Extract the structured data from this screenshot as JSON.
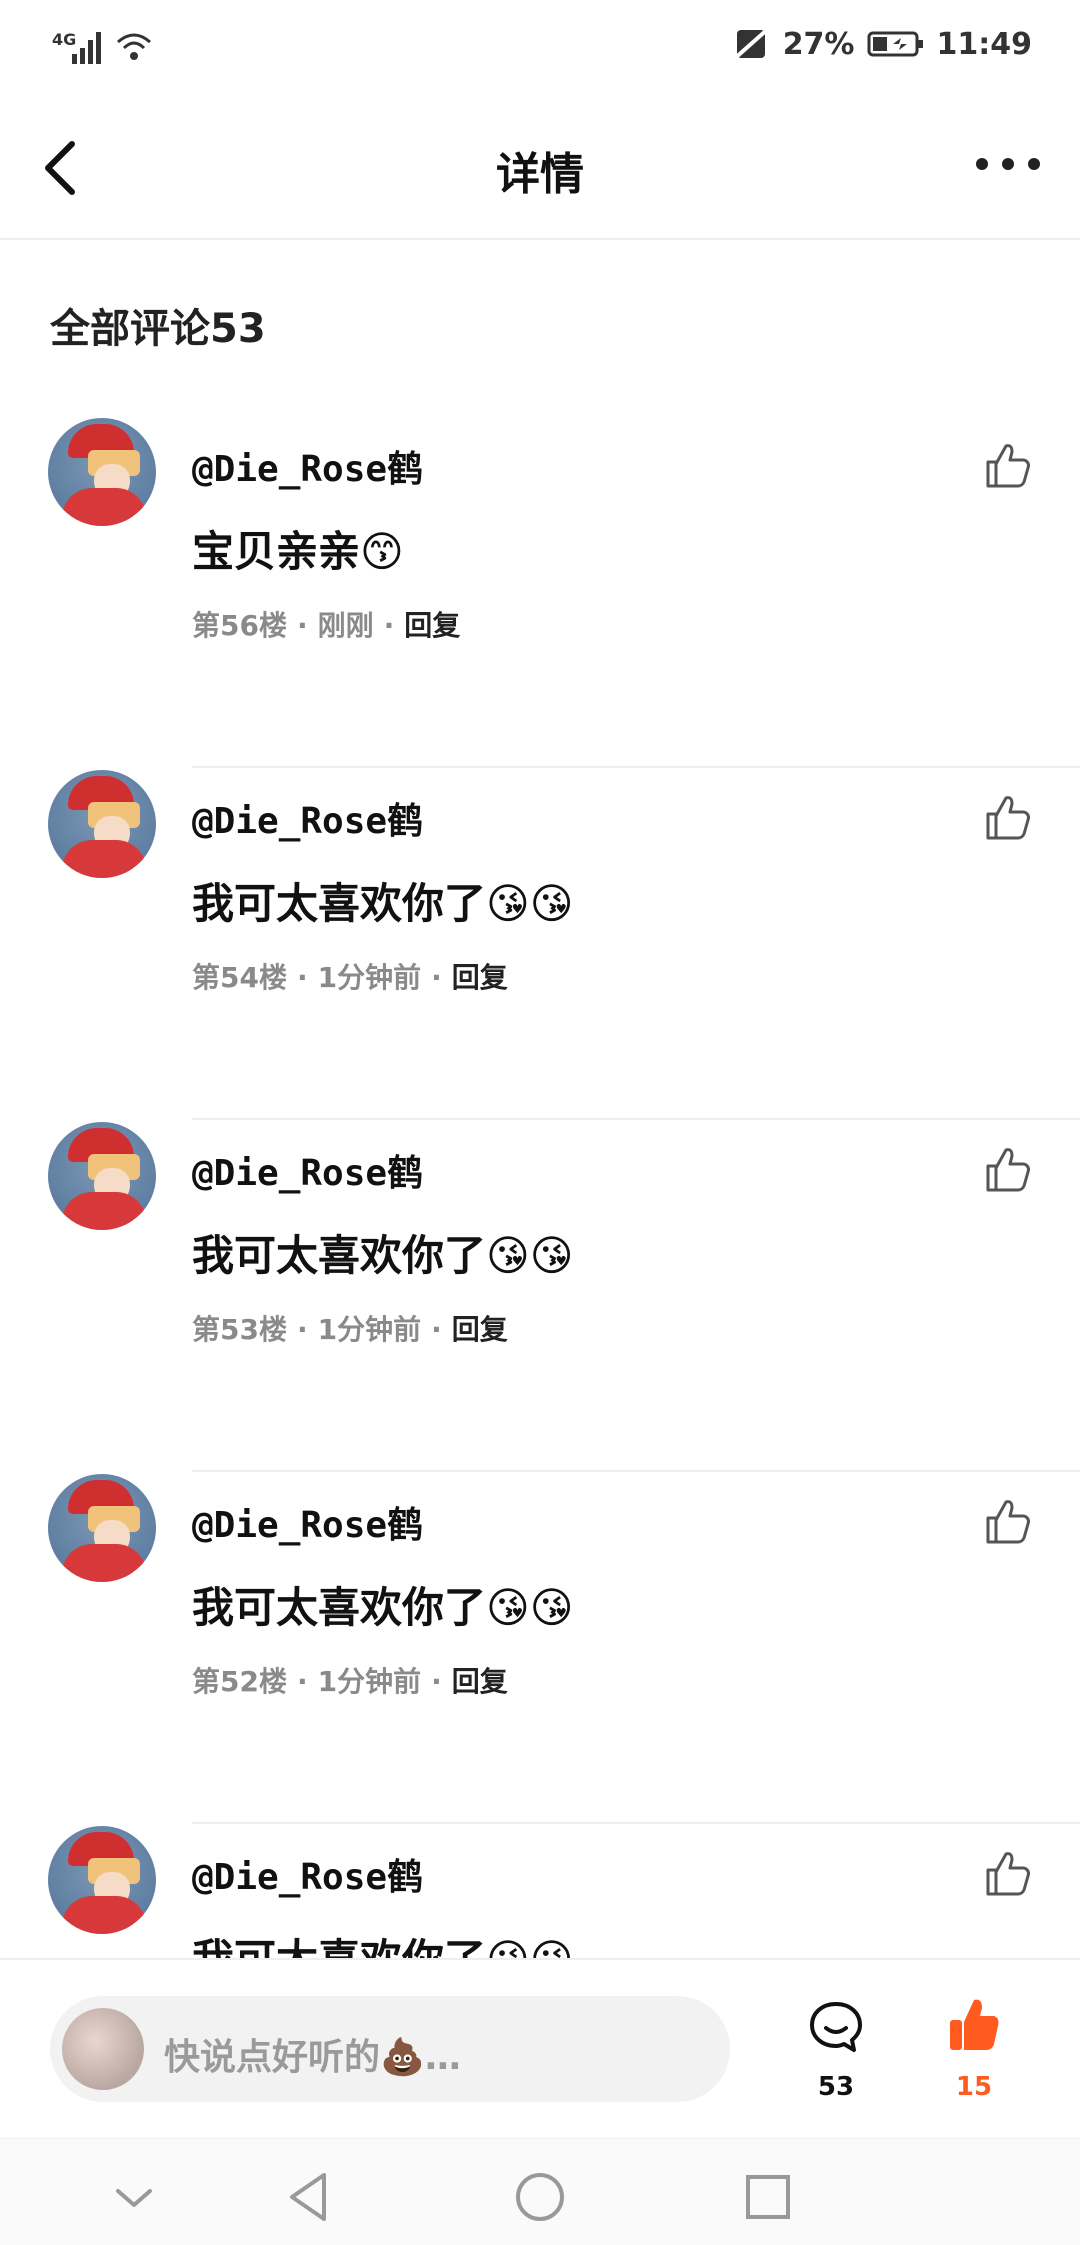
{
  "status_bar": {
    "network": "4G",
    "battery": "27%",
    "time": "11:49"
  },
  "header": {
    "title": "详情"
  },
  "comments_section": {
    "title": "全部评论53",
    "items": [
      {
        "username": "@Die_Rose鹤",
        "content": "宝贝亲亲😙",
        "floor": "第56楼",
        "time": "刚刚",
        "reply": "回复"
      },
      {
        "username": "@Die_Rose鹤",
        "content": "我可太喜欢你了😘😘",
        "floor": "第54楼",
        "time": "1分钟前",
        "reply": "回复"
      },
      {
        "username": "@Die_Rose鹤",
        "content": "我可太喜欢你了😘😘",
        "floor": "第53楼",
        "time": "1分钟前",
        "reply": "回复"
      },
      {
        "username": "@Die_Rose鹤",
        "content": "我可太喜欢你了😘😘",
        "floor": "第52楼",
        "time": "1分钟前",
        "reply": "回复"
      },
      {
        "username": "@Die_Rose鹤",
        "content": "我可太喜欢你了😘😘",
        "floor": "",
        "time": "",
        "reply": ""
      }
    ]
  },
  "bottom_bar": {
    "placeholder": "快说点好听的💩…",
    "comment_count": "53",
    "like_count": "15",
    "accent_color": "#ff5a1f"
  },
  "icons": {
    "back": "back-arrow-icon",
    "more": "more-dots-icon",
    "like": "thumbs-up-outline-icon",
    "comment": "comment-bubble-icon",
    "thumb_filled": "thumbs-up-filled-icon",
    "nav_hide": "chevron-down-icon",
    "nav_back": "triangle-back-icon",
    "nav_home": "circle-home-icon",
    "nav_recents": "square-recents-icon"
  }
}
